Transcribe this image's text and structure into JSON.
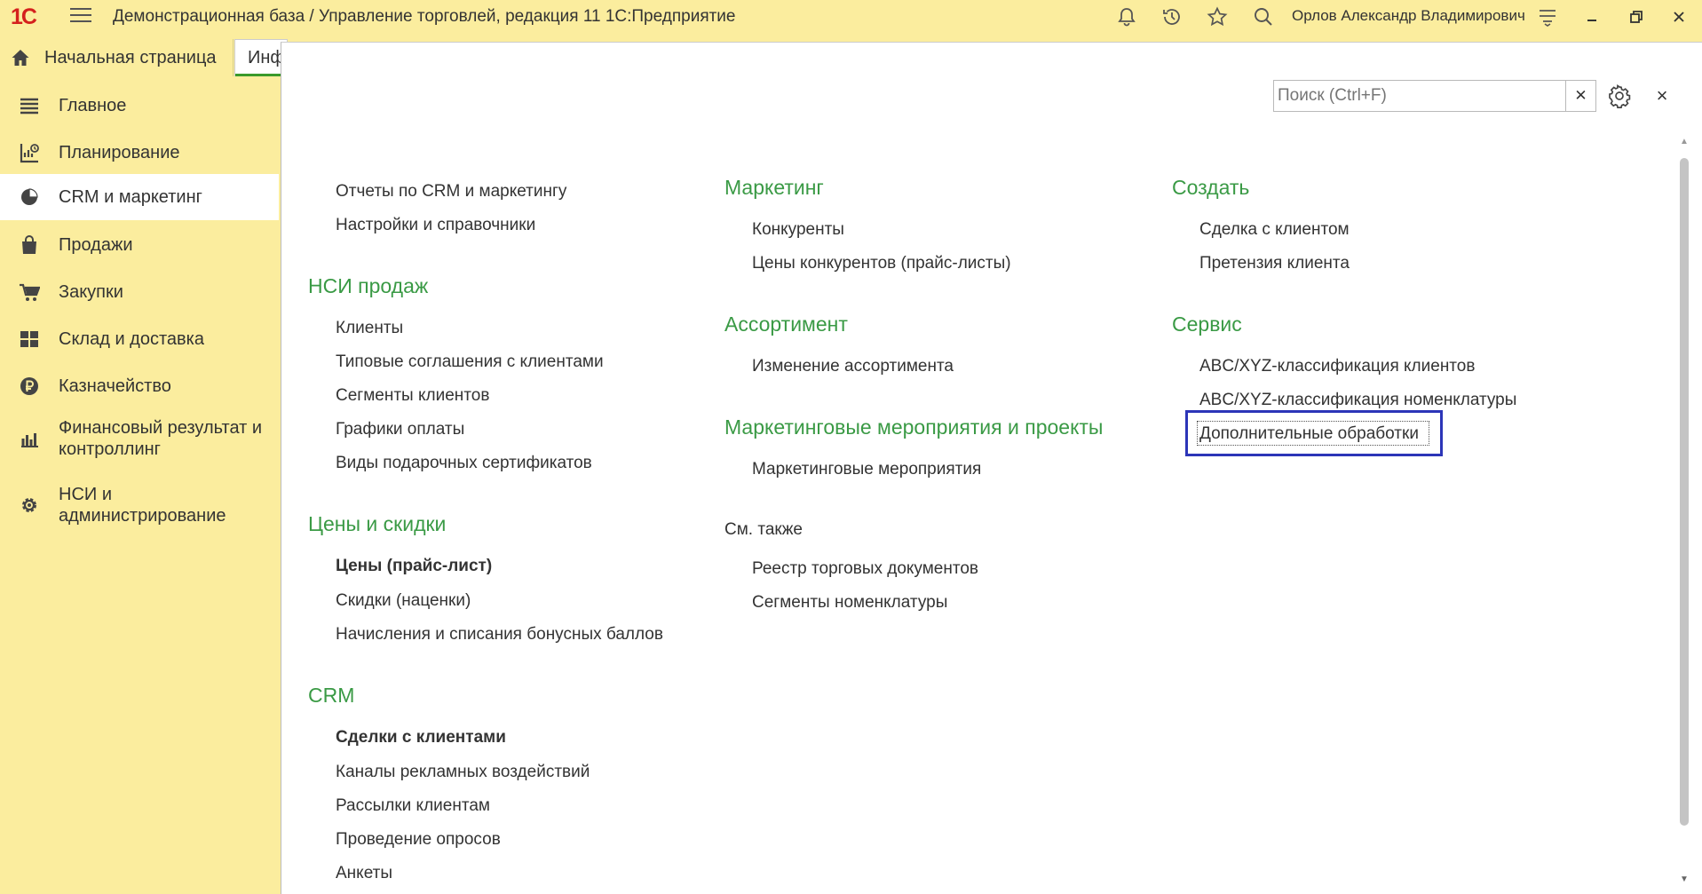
{
  "titlebar": {
    "logo": "1С",
    "title": "Демонстрационная база / Управление торговлей, редакция 11 1С:Предприятие",
    "user": "Орлов Александр Владимирович",
    "icons": [
      "bell-icon",
      "history-icon",
      "star-icon",
      "search-icon",
      "settings-lines-icon",
      "minimize-icon",
      "restore-icon",
      "close-icon"
    ]
  },
  "tabs": {
    "home": "Начальная страница",
    "info": "Инф"
  },
  "sidebar": {
    "items": [
      {
        "label": "Главное",
        "icon": "menu-lines-icon"
      },
      {
        "label": "Планирование",
        "icon": "planning-icon"
      },
      {
        "label": "CRM и маркетинг",
        "icon": "pie-chart-icon"
      },
      {
        "label": "Продажи",
        "icon": "shopping-bag-icon"
      },
      {
        "label": "Закупки",
        "icon": "cart-icon"
      },
      {
        "label": "Склад и доставка",
        "icon": "warehouse-icon"
      },
      {
        "label": "Казначейство",
        "icon": "ruble-icon"
      },
      {
        "label": "Финансовый результат и контроллинг",
        "label_line1": "Финансовый результат и",
        "label_line2": "контроллинг",
        "icon": "bar-chart-icon"
      },
      {
        "label": "НСИ и администрирование",
        "label_line1": "НСИ и",
        "label_line2": "администрирование",
        "icon": "gear-icon"
      }
    ],
    "active": "CRM и маркетинг"
  },
  "panel": {
    "search_placeholder": "Поиск (Ctrl+F)",
    "col1": {
      "top_links": [
        "Отчеты по CRM и маркетингу",
        "Настройки и справочники"
      ],
      "nsi_heading": "НСИ продаж",
      "nsi_links": [
        "Клиенты",
        "Типовые соглашения с клиентами",
        "Сегменты клиентов",
        "Графики оплаты",
        "Виды подарочных сертификатов"
      ],
      "prices_heading": "Цены и скидки",
      "prices_links": [
        "Цены (прайс-лист)",
        "Скидки (наценки)",
        "Начисления и списания бонусных баллов"
      ],
      "crm_heading": "CRM",
      "crm_links": [
        "Сделки с клиентами",
        "Каналы рекламных воздействий",
        "Рассылки клиентам",
        "Проведение опросов",
        "Анкеты"
      ]
    },
    "col2": {
      "marketing_heading": "Маркетинг",
      "marketing_links": [
        "Конкуренты",
        "Цены конкурентов (прайс-листы)"
      ],
      "assortment_heading": "Ассортимент",
      "assortment_links": [
        "Изменение ассортимента"
      ],
      "events_heading": "Маркетинговые мероприятия и проекты",
      "events_links": [
        "Маркетинговые мероприятия"
      ],
      "see_also": "См. также",
      "see_also_links": [
        "Реестр торговых документов",
        "Сегменты номенклатуры"
      ]
    },
    "col3": {
      "create_heading": "Создать",
      "create_links": [
        "Сделка с клиентом",
        "Претензия клиента"
      ],
      "service_heading": "Сервис",
      "service_links": [
        "ABC/XYZ-классификация клиентов",
        "ABC/XYZ-классификация номенклатуры",
        "Дополнительные обработки"
      ]
    }
  },
  "colors": {
    "accent_yellow": "#fbed9e",
    "heading_green": "#3a9a45",
    "highlight_blue": "#2c35b8",
    "logo_red": "#d4211d"
  }
}
